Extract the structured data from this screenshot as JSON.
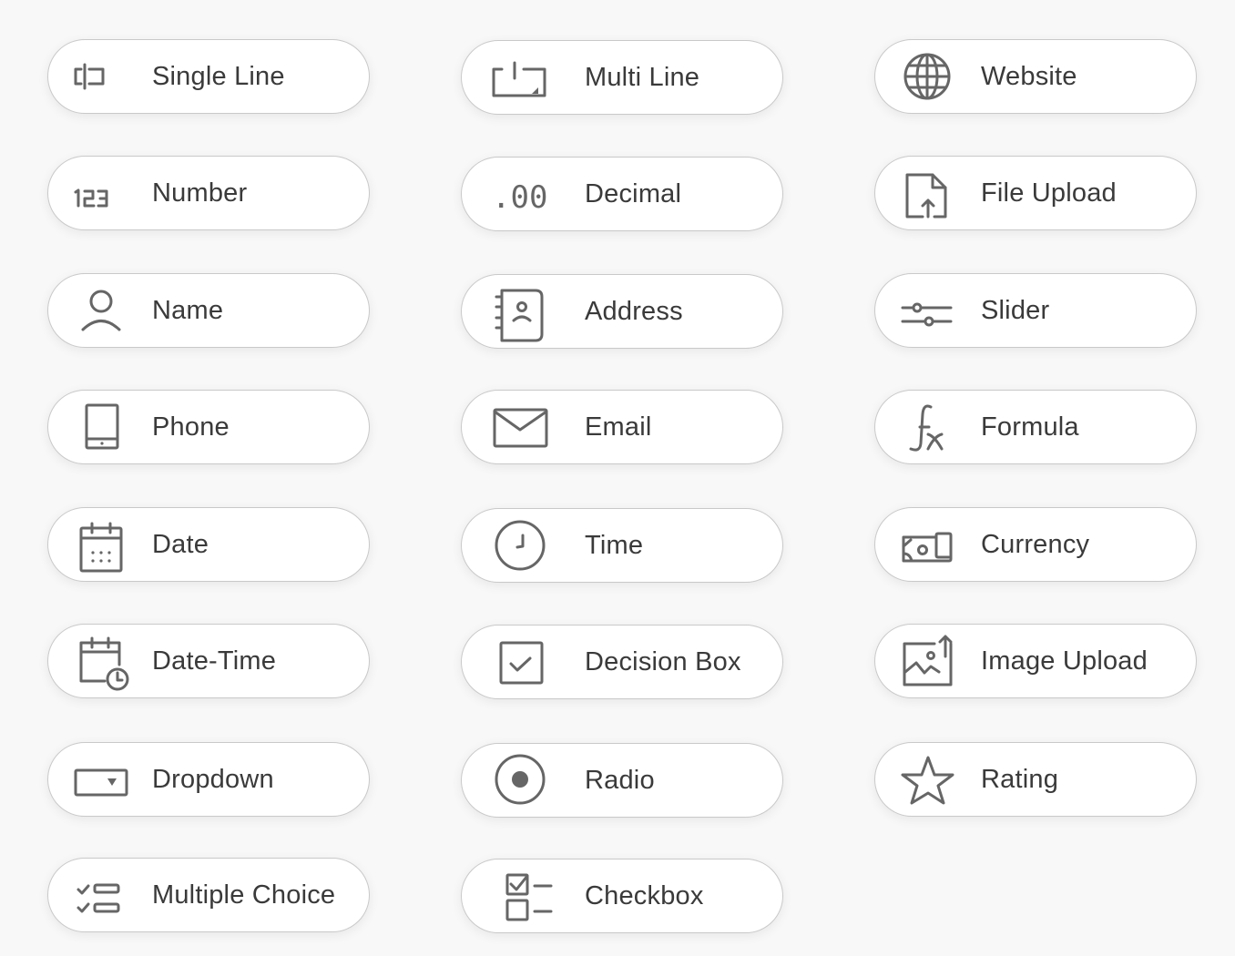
{
  "icon_color": "#666666",
  "text_color": "#3a3a3a",
  "border_color": "#c9c9c9",
  "background_color": "#f8f8f8",
  "fields": [
    {
      "label": "Single Line",
      "icon": "single-line-icon"
    },
    {
      "label": "Multi Line",
      "icon": "multi-line-icon"
    },
    {
      "label": "Website",
      "icon": "globe-icon"
    },
    {
      "label": "Number",
      "icon": "number-123-icon",
      "icon_text": "123"
    },
    {
      "label": "Decimal",
      "icon": "decimal-icon",
      "icon_text": ".00"
    },
    {
      "label": "File Upload",
      "icon": "file-upload-icon"
    },
    {
      "label": "Name",
      "icon": "person-icon"
    },
    {
      "label": "Address",
      "icon": "address-book-icon"
    },
    {
      "label": "Slider",
      "icon": "slider-icon"
    },
    {
      "label": "Phone",
      "icon": "phone-icon"
    },
    {
      "label": "Email",
      "icon": "envelope-icon"
    },
    {
      "label": "Formula",
      "icon": "formula-fx-icon"
    },
    {
      "label": "Date",
      "icon": "calendar-icon"
    },
    {
      "label": "Time",
      "icon": "clock-icon"
    },
    {
      "label": "Currency",
      "icon": "currency-note-icon"
    },
    {
      "label": "Date-Time",
      "icon": "calendar-clock-icon"
    },
    {
      "label": "Decision Box",
      "icon": "checked-box-icon"
    },
    {
      "label": "Image Upload",
      "icon": "image-upload-icon"
    },
    {
      "label": "Dropdown",
      "icon": "dropdown-icon"
    },
    {
      "label": "Radio",
      "icon": "radio-icon"
    },
    {
      "label": "Rating",
      "icon": "star-icon"
    },
    {
      "label": "Multiple Choice",
      "icon": "multiple-choice-icon"
    },
    {
      "label": "Checkbox",
      "icon": "checkbox-list-icon"
    }
  ]
}
